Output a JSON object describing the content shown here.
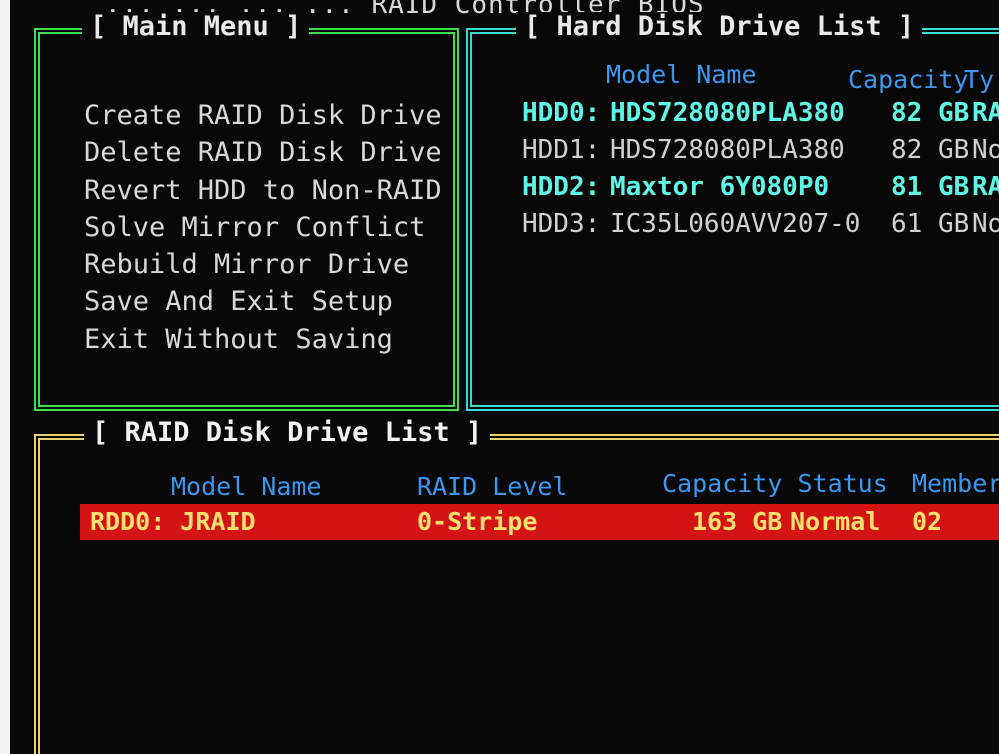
{
  "header": {
    "title_fragment": "... ... ... ... RAID Controller BIOS"
  },
  "main_menu": {
    "title": "[ Main Menu ]",
    "items": [
      "Create RAID Disk Drive",
      "Delete RAID Disk Drive",
      "Revert HDD to Non-RAID",
      "Solve Mirror Conflict",
      "Rebuild Mirror Drive",
      "Save And Exit Setup",
      "Exit Without Saving"
    ]
  },
  "hdd_list": {
    "title": "[ Hard Disk Drive List ]",
    "headers": {
      "model": "Model Name",
      "capacity": "Capacity",
      "type": "Ty"
    },
    "rows": [
      {
        "id": "HDD0:",
        "model": "HDS728080PLA380",
        "capacity": "82 GB",
        "type": "RA",
        "raid_member": true
      },
      {
        "id": "HDD1:",
        "model": "HDS728080PLA380",
        "capacity": "82 GB",
        "type": "Nor",
        "raid_member": false
      },
      {
        "id": "HDD2:",
        "model": "Maxtor 6Y080P0",
        "capacity": "81 GB",
        "type": "RA",
        "raid_member": true
      },
      {
        "id": "HDD3:",
        "model": "IC35L060AVV207-0",
        "capacity": "61 GB",
        "type": "Non",
        "raid_member": false
      }
    ]
  },
  "raid_list": {
    "title": "[ RAID Disk Drive List ]",
    "headers": {
      "model": "Model Name",
      "level": "RAID Level",
      "capacity_status": "Capacity Status",
      "members": "Members"
    },
    "rows": [
      {
        "id_model": "RDD0: JRAID",
        "level": "0-Stripe",
        "capacity": "163 GB",
        "status": "Normal",
        "members": "02"
      }
    ]
  },
  "colors": {
    "main_border": "#3ee04a",
    "hdd_border": "#37dcd0",
    "raid_border": "#e8d06a",
    "header_text": "#3a98f0",
    "raid_member_text": "#5ff6e6",
    "selected_row_bg": "#d41414",
    "selected_row_text": "#f7e070"
  }
}
